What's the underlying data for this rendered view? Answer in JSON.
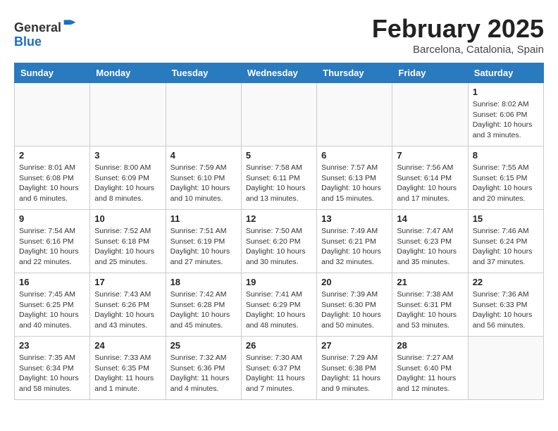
{
  "logo": {
    "general": "General",
    "blue": "Blue"
  },
  "title": "February 2025",
  "subtitle": "Barcelona, Catalonia, Spain",
  "days_of_week": [
    "Sunday",
    "Monday",
    "Tuesday",
    "Wednesday",
    "Thursday",
    "Friday",
    "Saturday"
  ],
  "weeks": [
    [
      {
        "day": "",
        "info": ""
      },
      {
        "day": "",
        "info": ""
      },
      {
        "day": "",
        "info": ""
      },
      {
        "day": "",
        "info": ""
      },
      {
        "day": "",
        "info": ""
      },
      {
        "day": "",
        "info": ""
      },
      {
        "day": "1",
        "info": "Sunrise: 8:02 AM\nSunset: 6:06 PM\nDaylight: 10 hours and 3 minutes."
      }
    ],
    [
      {
        "day": "2",
        "info": "Sunrise: 8:01 AM\nSunset: 6:08 PM\nDaylight: 10 hours and 6 minutes."
      },
      {
        "day": "3",
        "info": "Sunrise: 8:00 AM\nSunset: 6:09 PM\nDaylight: 10 hours and 8 minutes."
      },
      {
        "day": "4",
        "info": "Sunrise: 7:59 AM\nSunset: 6:10 PM\nDaylight: 10 hours and 10 minutes."
      },
      {
        "day": "5",
        "info": "Sunrise: 7:58 AM\nSunset: 6:11 PM\nDaylight: 10 hours and 13 minutes."
      },
      {
        "day": "6",
        "info": "Sunrise: 7:57 AM\nSunset: 6:13 PM\nDaylight: 10 hours and 15 minutes."
      },
      {
        "day": "7",
        "info": "Sunrise: 7:56 AM\nSunset: 6:14 PM\nDaylight: 10 hours and 17 minutes."
      },
      {
        "day": "8",
        "info": "Sunrise: 7:55 AM\nSunset: 6:15 PM\nDaylight: 10 hours and 20 minutes."
      }
    ],
    [
      {
        "day": "9",
        "info": "Sunrise: 7:54 AM\nSunset: 6:16 PM\nDaylight: 10 hours and 22 minutes."
      },
      {
        "day": "10",
        "info": "Sunrise: 7:52 AM\nSunset: 6:18 PM\nDaylight: 10 hours and 25 minutes."
      },
      {
        "day": "11",
        "info": "Sunrise: 7:51 AM\nSunset: 6:19 PM\nDaylight: 10 hours and 27 minutes."
      },
      {
        "day": "12",
        "info": "Sunrise: 7:50 AM\nSunset: 6:20 PM\nDaylight: 10 hours and 30 minutes."
      },
      {
        "day": "13",
        "info": "Sunrise: 7:49 AM\nSunset: 6:21 PM\nDaylight: 10 hours and 32 minutes."
      },
      {
        "day": "14",
        "info": "Sunrise: 7:47 AM\nSunset: 6:23 PM\nDaylight: 10 hours and 35 minutes."
      },
      {
        "day": "15",
        "info": "Sunrise: 7:46 AM\nSunset: 6:24 PM\nDaylight: 10 hours and 37 minutes."
      }
    ],
    [
      {
        "day": "16",
        "info": "Sunrise: 7:45 AM\nSunset: 6:25 PM\nDaylight: 10 hours and 40 minutes."
      },
      {
        "day": "17",
        "info": "Sunrise: 7:43 AM\nSunset: 6:26 PM\nDaylight: 10 hours and 43 minutes."
      },
      {
        "day": "18",
        "info": "Sunrise: 7:42 AM\nSunset: 6:28 PM\nDaylight: 10 hours and 45 minutes."
      },
      {
        "day": "19",
        "info": "Sunrise: 7:41 AM\nSunset: 6:29 PM\nDaylight: 10 hours and 48 minutes."
      },
      {
        "day": "20",
        "info": "Sunrise: 7:39 AM\nSunset: 6:30 PM\nDaylight: 10 hours and 50 minutes."
      },
      {
        "day": "21",
        "info": "Sunrise: 7:38 AM\nSunset: 6:31 PM\nDaylight: 10 hours and 53 minutes."
      },
      {
        "day": "22",
        "info": "Sunrise: 7:36 AM\nSunset: 6:33 PM\nDaylight: 10 hours and 56 minutes."
      }
    ],
    [
      {
        "day": "23",
        "info": "Sunrise: 7:35 AM\nSunset: 6:34 PM\nDaylight: 10 hours and 58 minutes."
      },
      {
        "day": "24",
        "info": "Sunrise: 7:33 AM\nSunset: 6:35 PM\nDaylight: 11 hours and 1 minute."
      },
      {
        "day": "25",
        "info": "Sunrise: 7:32 AM\nSunset: 6:36 PM\nDaylight: 11 hours and 4 minutes."
      },
      {
        "day": "26",
        "info": "Sunrise: 7:30 AM\nSunset: 6:37 PM\nDaylight: 11 hours and 7 minutes."
      },
      {
        "day": "27",
        "info": "Sunrise: 7:29 AM\nSunset: 6:38 PM\nDaylight: 11 hours and 9 minutes."
      },
      {
        "day": "28",
        "info": "Sunrise: 7:27 AM\nSunset: 6:40 PM\nDaylight: 11 hours and 12 minutes."
      },
      {
        "day": "",
        "info": ""
      }
    ]
  ]
}
